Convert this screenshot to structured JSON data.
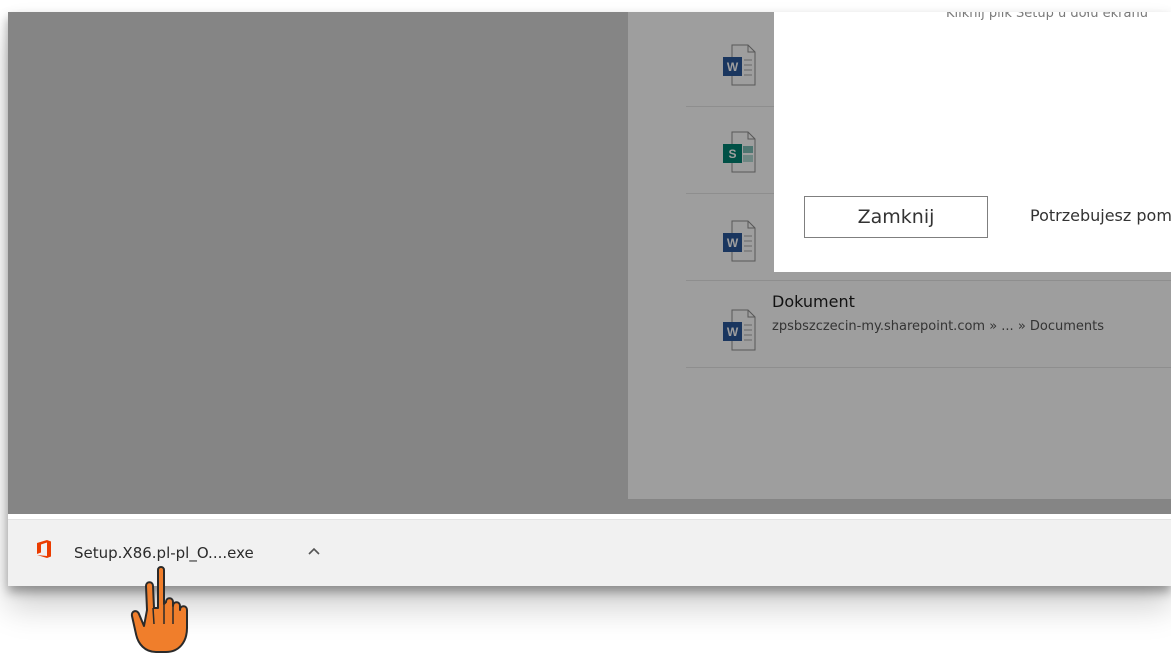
{
  "dialog": {
    "hint_text": "Kliknij plik Setup u dołu ekranu",
    "close_label": "Zamknij",
    "help_text": "Potrzebujesz pomocy?"
  },
  "files": [
    {
      "type": "word",
      "icon": "word-doc-icon",
      "name": "",
      "path": ""
    },
    {
      "type": "sway",
      "icon": "sway-icon",
      "name": "",
      "path": ""
    },
    {
      "type": "word",
      "icon": "word-doc-icon",
      "name": "",
      "path": ""
    },
    {
      "type": "word",
      "icon": "word-doc-icon",
      "name": "Dokument",
      "path": "zpsbszczecin-my.sharepoint.com » ... » Documents"
    }
  ],
  "download_bar": {
    "file_name": "Setup.X86.pl-pl_O....exe",
    "icon": "office-logo-icon",
    "chevron": "chevron-up-icon"
  },
  "pointer": {
    "icon": "hand-pointer-icon"
  },
  "colors": {
    "word": "#2b579a",
    "sway": "#008272",
    "office": "#eb3c00",
    "pointer": "#f07e2b"
  }
}
